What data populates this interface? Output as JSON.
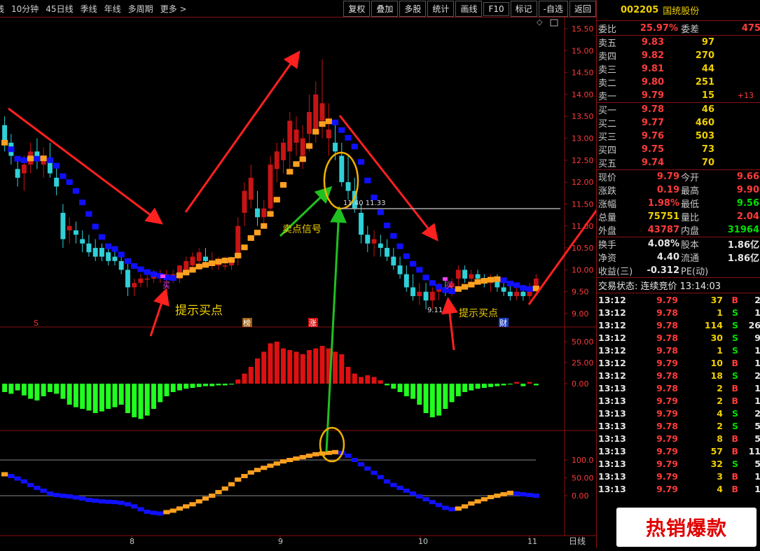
{
  "toolbar": {
    "periods": [
      "线",
      "10分钟",
      "45日线",
      "季线",
      "年线",
      "多周期",
      "更多 >"
    ],
    "buttons": [
      "复权",
      "叠加",
      "多股",
      "统计",
      "画线",
      "F10",
      "标记",
      "-自选",
      "返回"
    ]
  },
  "stock": {
    "code": "002205",
    "name": "国统股份"
  },
  "weibi": {
    "label": "委比",
    "value": "25.97%",
    "diff_label": "委差",
    "diff": "475"
  },
  "sell": [
    {
      "label": "卖五",
      "price": "9.83",
      "vol": "97",
      "chg": ""
    },
    {
      "label": "卖四",
      "price": "9.82",
      "vol": "270",
      "chg": ""
    },
    {
      "label": "卖三",
      "price": "9.81",
      "vol": "44",
      "chg": ""
    },
    {
      "label": "卖二",
      "price": "9.80",
      "vol": "251",
      "chg": ""
    },
    {
      "label": "卖一",
      "price": "9.79",
      "vol": "15",
      "chg": "+13"
    }
  ],
  "buy": [
    {
      "label": "买一",
      "price": "9.78",
      "vol": "46"
    },
    {
      "label": "买二",
      "price": "9.77",
      "vol": "460"
    },
    {
      "label": "买三",
      "price": "9.76",
      "vol": "503"
    },
    {
      "label": "买四",
      "price": "9.75",
      "vol": "73"
    },
    {
      "label": "买五",
      "price": "9.74",
      "vol": "70"
    }
  ],
  "stats1": [
    {
      "k": "现价",
      "v": "9.79",
      "vc": "red",
      "k2": "今开",
      "v2": "9.66",
      "v2c": "red"
    },
    {
      "k": "涨跌",
      "v": "0.19",
      "vc": "red",
      "k2": "最高",
      "v2": "9.90",
      "v2c": "red"
    },
    {
      "k": "涨幅",
      "v": "1.98%",
      "vc": "red",
      "k2": "最低",
      "v2": "9.56",
      "v2c": "green"
    },
    {
      "k": "总量",
      "v": "75751",
      "vc": "yellow",
      "k2": "量比",
      "v2": "2.04",
      "v2c": "red"
    },
    {
      "k": "外盘",
      "v": "43787",
      "vc": "red",
      "k2": "内盘",
      "v2": "31964",
      "v2c": "green"
    }
  ],
  "stats2": [
    {
      "k": "换手",
      "v": "4.08%",
      "vc": "white",
      "k2": "股本",
      "v2": "1.86亿",
      "v2c": "white"
    },
    {
      "k": "净资",
      "v": "4.40",
      "vc": "white",
      "k2": "流通",
      "v2": "1.86亿",
      "v2c": "white"
    },
    {
      "k": "收益(三)",
      "v": "-0.312",
      "vc": "white",
      "k2": "PE(动)",
      "v2": "",
      "v2c": "white"
    }
  ],
  "trade_status": "交易状态: 连续竞价 13:14:03",
  "ticks": [
    {
      "t": "13:12",
      "p": "9.79",
      "pc": "red",
      "v": "37",
      "d": "B",
      "dc": "red",
      "n": "2"
    },
    {
      "t": "13:12",
      "p": "9.78",
      "pc": "red",
      "v": "1",
      "d": "S",
      "dc": "green",
      "n": "1"
    },
    {
      "t": "13:12",
      "p": "9.78",
      "pc": "red",
      "v": "114",
      "d": "S",
      "dc": "green",
      "n": "26"
    },
    {
      "t": "13:12",
      "p": "9.78",
      "pc": "red",
      "v": "30",
      "d": "S",
      "dc": "green",
      "n": "9"
    },
    {
      "t": "13:12",
      "p": "9.78",
      "pc": "red",
      "v": "1",
      "d": "S",
      "dc": "green",
      "n": "1"
    },
    {
      "t": "13:12",
      "p": "9.79",
      "pc": "red",
      "v": "10",
      "d": "B",
      "dc": "red",
      "n": "1"
    },
    {
      "t": "13:12",
      "p": "9.78",
      "pc": "red",
      "v": "18",
      "d": "S",
      "dc": "green",
      "n": "2"
    },
    {
      "t": "13:13",
      "p": "9.78",
      "pc": "red",
      "v": "2",
      "d": "B",
      "dc": "red",
      "n": "1"
    },
    {
      "t": "13:13",
      "p": "9.79",
      "pc": "red",
      "v": "2",
      "d": "B",
      "dc": "red",
      "n": "1"
    },
    {
      "t": "13:13",
      "p": "9.79",
      "pc": "red",
      "v": "4",
      "d": "S",
      "dc": "green",
      "n": "2"
    },
    {
      "t": "13:13",
      "p": "9.78",
      "pc": "red",
      "v": "2",
      "d": "S",
      "dc": "green",
      "n": "5"
    },
    {
      "t": "13:13",
      "p": "9.79",
      "pc": "red",
      "v": "8",
      "d": "B",
      "dc": "red",
      "n": "5"
    },
    {
      "t": "13:13",
      "p": "9.79",
      "pc": "red",
      "v": "57",
      "d": "B",
      "dc": "red",
      "n": "11"
    },
    {
      "t": "13:13",
      "p": "9.79",
      "pc": "red",
      "v": "32",
      "d": "S",
      "dc": "green",
      "n": "5"
    },
    {
      "t": "13:13",
      "p": "9.79",
      "pc": "red",
      "v": "3",
      "d": "B",
      "dc": "red",
      "n": "1"
    },
    {
      "t": "13:13",
      "p": "9.79",
      "pc": "red",
      "v": "4",
      "d": "B",
      "dc": "red",
      "n": "1"
    }
  ],
  "badge": "热销爆款",
  "chart_data": {
    "type": "candlestick",
    "price_axis": [
      "15.50",
      "15.00",
      "14.50",
      "14.00",
      "13.50",
      "13.00",
      "12.50",
      "12.00",
      "11.50",
      "11.00",
      "10.50",
      "10.00",
      "9.50",
      "9.00"
    ],
    "macd_axis": [
      "50.00",
      "25.00",
      "0.00"
    ],
    "osc_axis": [
      "100.0",
      "50.00",
      "0.00"
    ],
    "x_labels": [
      "8",
      "9",
      "10",
      "11"
    ],
    "x_unit": "日线",
    "annotations": {
      "buy_hint_1": "提示买点",
      "buy_hint_2": "提示买点",
      "sell_signal": "卖点信号",
      "high_label": "11.40 11.33",
      "low_label": "9.11",
      "buy_marker": "买",
      "s_marker": "S",
      "bang_marker": "榜",
      "zhang_marker": "涨",
      "cai_marker": "财"
    },
    "candles": [
      [
        13.3,
        13.5,
        12.7,
        12.9
      ],
      [
        12.9,
        13.1,
        12.4,
        12.6
      ],
      [
        12.3,
        12.6,
        11.9,
        12.1
      ],
      [
        12.2,
        12.6,
        11.8,
        12.4
      ],
      [
        12.4,
        12.9,
        12.2,
        12.7
      ],
      [
        12.7,
        13.0,
        12.3,
        12.5
      ],
      [
        12.4,
        12.8,
        12.1,
        12.6
      ],
      [
        12.5,
        12.9,
        12.1,
        12.2
      ],
      [
        12.1,
        12.4,
        11.7,
        11.9
      ],
      [
        11.3,
        11.5,
        10.5,
        10.7
      ],
      [
        10.9,
        11.2,
        10.6,
        11.0
      ],
      [
        10.9,
        11.1,
        10.6,
        10.8
      ],
      [
        10.7,
        10.9,
        10.4,
        10.6
      ],
      [
        10.6,
        10.8,
        10.3,
        10.4
      ],
      [
        10.5,
        10.7,
        10.2,
        10.3
      ],
      [
        10.5,
        10.6,
        10.2,
        10.3
      ],
      [
        10.4,
        10.6,
        10.1,
        10.2
      ],
      [
        10.3,
        10.5,
        10.1,
        10.2
      ],
      [
        10.2,
        10.4,
        9.9,
        10.0
      ],
      [
        10.0,
        10.2,
        9.4,
        9.6
      ],
      [
        9.6,
        9.8,
        9.4,
        9.7
      ],
      [
        9.7,
        9.9,
        9.6,
        9.8
      ],
      [
        9.8,
        9.9,
        9.6,
        9.8
      ],
      [
        9.8,
        10.0,
        9.7,
        9.9
      ],
      [
        9.8,
        10.0,
        9.7,
        9.9
      ],
      [
        9.8,
        10.0,
        9.7,
        9.9
      ],
      [
        9.8,
        10.0,
        9.7,
        9.9
      ],
      [
        9.8,
        10.0,
        9.7,
        10.1
      ],
      [
        10.0,
        10.3,
        9.9,
        10.2
      ],
      [
        10.1,
        10.4,
        10.0,
        10.3
      ],
      [
        10.2,
        10.5,
        10.0,
        10.4
      ],
      [
        10.3,
        10.5,
        10.1,
        10.2
      ],
      [
        10.2,
        10.4,
        10.0,
        10.2
      ],
      [
        10.1,
        10.3,
        10.0,
        10.2
      ],
      [
        10.1,
        10.3,
        10.0,
        10.1
      ],
      [
        10.1,
        10.3,
        10.0,
        10.2
      ],
      [
        10.3,
        11.2,
        10.1,
        11.0
      ],
      [
        11.3,
        12.0,
        11.0,
        11.8
      ],
      [
        11.6,
        12.4,
        11.4,
        12.1
      ],
      [
        11.4,
        11.8,
        11.0,
        11.2
      ],
      [
        11.2,
        11.6,
        11.0,
        11.4
      ],
      [
        11.4,
        12.6,
        11.2,
        12.4
      ],
      [
        12.3,
        12.9,
        12.0,
        12.7
      ],
      [
        12.5,
        13.0,
        12.2,
        12.9
      ],
      [
        12.7,
        13.6,
        12.3,
        13.4
      ],
      [
        12.9,
        13.5,
        12.6,
        13.2
      ],
      [
        12.6,
        13.3,
        12.3,
        13.0
      ],
      [
        13.1,
        14.0,
        12.7,
        13.6
      ],
      [
        13.2,
        14.3,
        12.9,
        14.0
      ],
      [
        13.4,
        14.8,
        13.0,
        13.8
      ],
      [
        13.0,
        13.8,
        12.6,
        13.2
      ],
      [
        12.9,
        13.4,
        12.5,
        12.7
      ],
      [
        12.6,
        12.9,
        11.9,
        12.0
      ],
      [
        12.0,
        12.6,
        11.6,
        11.8
      ],
      [
        11.8,
        12.1,
        11.3,
        11.4
      ],
      [
        11.3,
        11.5,
        10.6,
        10.8
      ],
      [
        10.8,
        11.0,
        10.4,
        10.6
      ],
      [
        10.6,
        10.9,
        10.3,
        10.7
      ],
      [
        10.6,
        10.8,
        10.3,
        10.5
      ],
      [
        10.5,
        10.7,
        10.2,
        10.3
      ],
      [
        10.3,
        10.5,
        10.0,
        10.1
      ],
      [
        10.1,
        10.3,
        9.8,
        9.9
      ],
      [
        9.9,
        10.1,
        9.5,
        9.6
      ],
      [
        9.6,
        9.9,
        9.3,
        9.4
      ],
      [
        9.4,
        9.7,
        9.2,
        9.5
      ],
      [
        9.5,
        9.7,
        9.1,
        9.3
      ],
      [
        9.3,
        9.6,
        9.1,
        9.5
      ],
      [
        9.5,
        9.7,
        9.3,
        9.6
      ],
      [
        9.6,
        9.8,
        9.4,
        9.5
      ],
      [
        9.6,
        9.8,
        9.4,
        9.7
      ],
      [
        9.8,
        10.1,
        9.6,
        10.0
      ],
      [
        10.0,
        10.1,
        9.7,
        9.8
      ],
      [
        9.8,
        10.0,
        9.6,
        9.9
      ],
      [
        9.9,
        10.0,
        9.7,
        9.8
      ],
      [
        9.8,
        9.9,
        9.6,
        9.7
      ],
      [
        9.7,
        9.9,
        9.5,
        9.8
      ],
      [
        9.8,
        9.9,
        9.5,
        9.6
      ],
      [
        9.6,
        9.8,
        9.4,
        9.5
      ],
      [
        9.5,
        9.7,
        9.3,
        9.4
      ],
      [
        9.4,
        9.6,
        9.3,
        9.5
      ],
      [
        9.5,
        9.6,
        9.3,
        9.4
      ],
      [
        9.4,
        9.7,
        9.3,
        9.6
      ],
      [
        9.6,
        9.9,
        9.5,
        9.8
      ]
    ],
    "macd": [
      -10,
      -12,
      -8,
      -14,
      -18,
      -20,
      -15,
      -10,
      -12,
      -18,
      -25,
      -28,
      -30,
      -32,
      -35,
      -33,
      -30,
      -28,
      -25,
      -35,
      -40,
      -42,
      -38,
      -30,
      -22,
      -15,
      -10,
      -8,
      -6,
      -5,
      -4,
      -3,
      -3,
      -2,
      -2,
      -1,
      5,
      12,
      20,
      30,
      38,
      48,
      50,
      42,
      40,
      38,
      35,
      40,
      42,
      45,
      42,
      38,
      35,
      20,
      12,
      8,
      10,
      8,
      4,
      -2,
      -6,
      -10,
      -15,
      -18,
      -25,
      -35,
      -40,
      -38,
      -30,
      -22,
      -15,
      -10,
      -8,
      -6,
      -5,
      -4,
      -3,
      -2,
      -1,
      2,
      -3,
      2,
      -2,
      3,
      -1,
      2
    ],
    "osc": [
      60,
      55,
      48,
      40,
      30,
      22,
      14,
      6,
      2,
      0,
      -2,
      -5,
      -8,
      -12,
      -14,
      -16,
      -17,
      -18,
      -20,
      -24,
      -30,
      -38,
      -45,
      -48,
      -50,
      -46,
      -42,
      -36,
      -30,
      -24,
      -16,
      -8,
      0,
      10,
      20,
      32,
      45,
      55,
      65,
      72,
      78,
      84,
      90,
      96,
      100,
      104,
      108,
      112,
      116,
      118,
      120,
      122,
      120,
      112,
      100,
      88,
      76,
      64,
      52,
      40,
      30,
      22,
      14,
      6,
      -2,
      -10,
      -18,
      -26,
      -34,
      -38,
      -36,
      -30,
      -22,
      -16,
      -10,
      -4,
      0,
      4,
      8,
      6,
      4,
      2,
      0,
      -4,
      -6,
      -8,
      -4,
      2
    ]
  }
}
